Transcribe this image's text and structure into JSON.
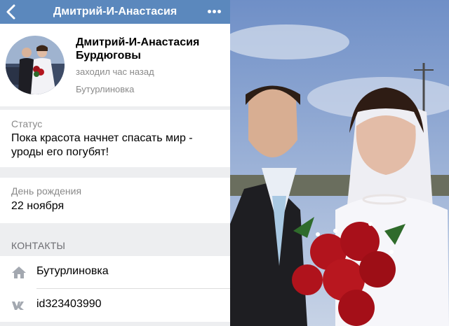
{
  "header": {
    "title": "Дмитрий-И-Анастасия"
  },
  "profile": {
    "name_line1": "Дмитрий-И-Анастасия",
    "name_line2": "Бурдюговы",
    "last_seen": "заходил час назад",
    "city": "Бутурлиновка"
  },
  "status": {
    "label": "Статус",
    "text_line1": "Пока красота начнет спасать мир -",
    "text_line2": "уроды его погубят!"
  },
  "birthday": {
    "label": "День рождения",
    "value": "22 ноября"
  },
  "contacts": {
    "heading": "КОНТАКТЫ",
    "items": [
      {
        "icon": "home-icon",
        "text": "Бутурлиновка"
      },
      {
        "icon": "vk-icon",
        "text": "id323403990"
      }
    ]
  },
  "colors": {
    "navbar": "#5b88bd",
    "background": "#edeef0",
    "secondary_text": "#8a8a8a"
  }
}
